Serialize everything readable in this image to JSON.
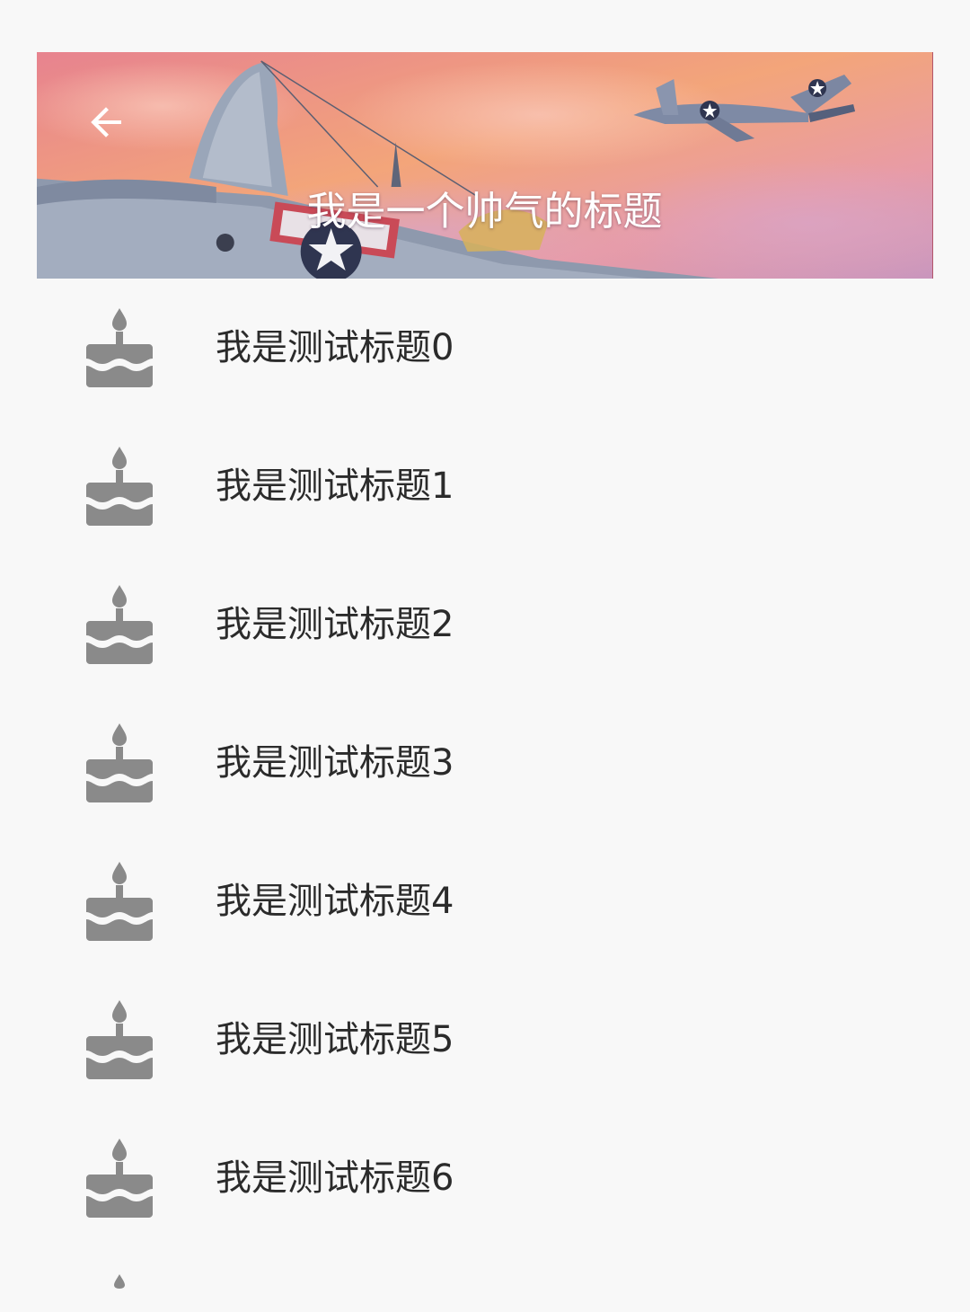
{
  "header": {
    "back_icon": "arrow-left-icon",
    "title": "我是一个帅气的标题",
    "colors": {
      "sky_top": "#e98f97",
      "sky_mid": "#f3a77c",
      "sky_bottom": "#cc93b8",
      "title_text": "#ffffff"
    }
  },
  "list": {
    "icon": "cake-icon",
    "icon_color": "#8a8a8a",
    "items": [
      {
        "label": "我是测试标题0"
      },
      {
        "label": "我是测试标题1"
      },
      {
        "label": "我是测试标题2"
      },
      {
        "label": "我是测试标题3"
      },
      {
        "label": "我是测试标题4"
      },
      {
        "label": "我是测试标题5"
      },
      {
        "label": "我是测试标题6"
      }
    ]
  }
}
